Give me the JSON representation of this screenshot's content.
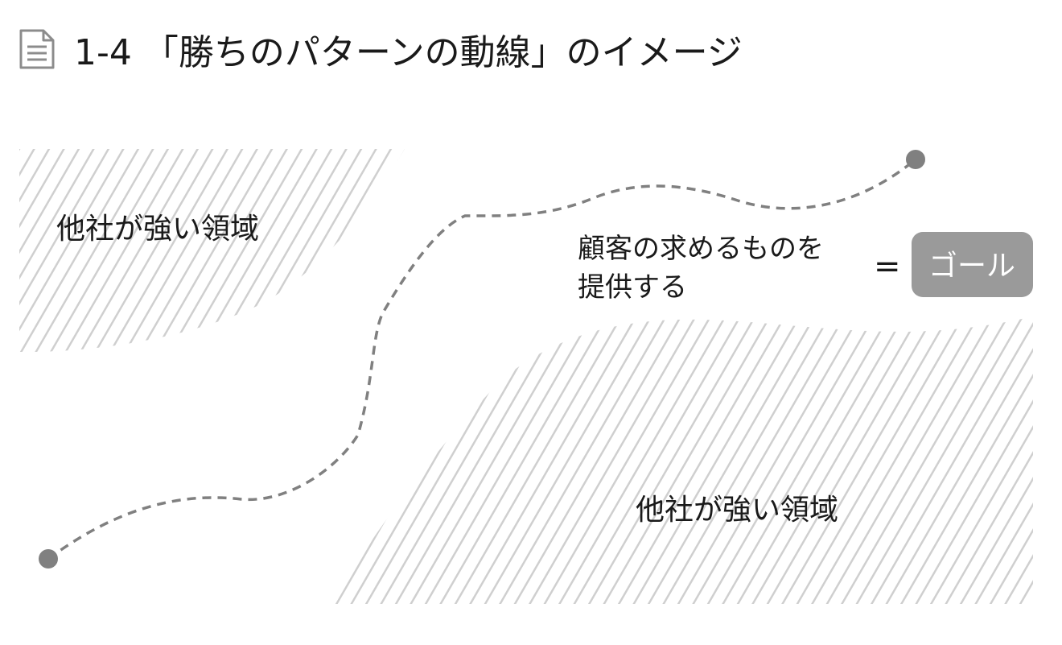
{
  "title": "1-4 「勝ちのパターンの動線」のイメージ",
  "icon": "document-icon",
  "regions": {
    "top_left_label": "他社が強い領域",
    "bottom_right_label": "他社が強い領域"
  },
  "goal": {
    "description_line1": "顧客の求めるものを",
    "description_line2": "提供する",
    "equals": "=",
    "badge_label": "ゴール"
  },
  "colors": {
    "hatch": "#cfcfcf",
    "path": "#808080",
    "badge": "#9a9a9a",
    "icon": "#8c8c8c",
    "text": "#1a1a1a"
  }
}
